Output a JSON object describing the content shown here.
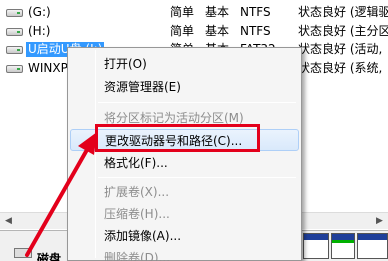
{
  "volumes": [
    {
      "name": "(G:)",
      "layout": "简单",
      "type": "基本",
      "fs": "NTFS",
      "status": "状态良好 (逻辑驱",
      "selected": false
    },
    {
      "name": "(H:)",
      "layout": "简单",
      "type": "基本",
      "fs": "NTFS",
      "status": "状态良好 (主分区",
      "selected": false
    },
    {
      "name": "U启动U盘 (I:)",
      "layout": "简单",
      "type": "基本",
      "fs": "FAT32",
      "status": "状态良好 (活动,",
      "selected": true
    },
    {
      "name": "WINXP",
      "layout": "",
      "type": "",
      "fs": "",
      "status": "状态良好 (系统,",
      "selected": false
    }
  ],
  "context_menu": {
    "items": [
      {
        "label": "打开(O)",
        "disabled": false
      },
      {
        "label": "资源管理器(E)",
        "disabled": false
      },
      {
        "label": "将分区标记为活动分区(M)",
        "disabled": true
      },
      {
        "label": "更改驱动器号和路径(C)...",
        "disabled": false,
        "highlighted": true
      },
      {
        "label": "格式化(F)...",
        "disabled": false
      },
      {
        "label": "扩展卷(X)...",
        "disabled": true
      },
      {
        "label": "压缩卷(H)...",
        "disabled": true
      },
      {
        "label": "添加镜像(A)...",
        "disabled": false
      },
      {
        "label": "删除卷(D)...",
        "disabled": true
      }
    ]
  },
  "disk_strip": {
    "label": "磁盘"
  },
  "annotation_color": "#e3001b"
}
